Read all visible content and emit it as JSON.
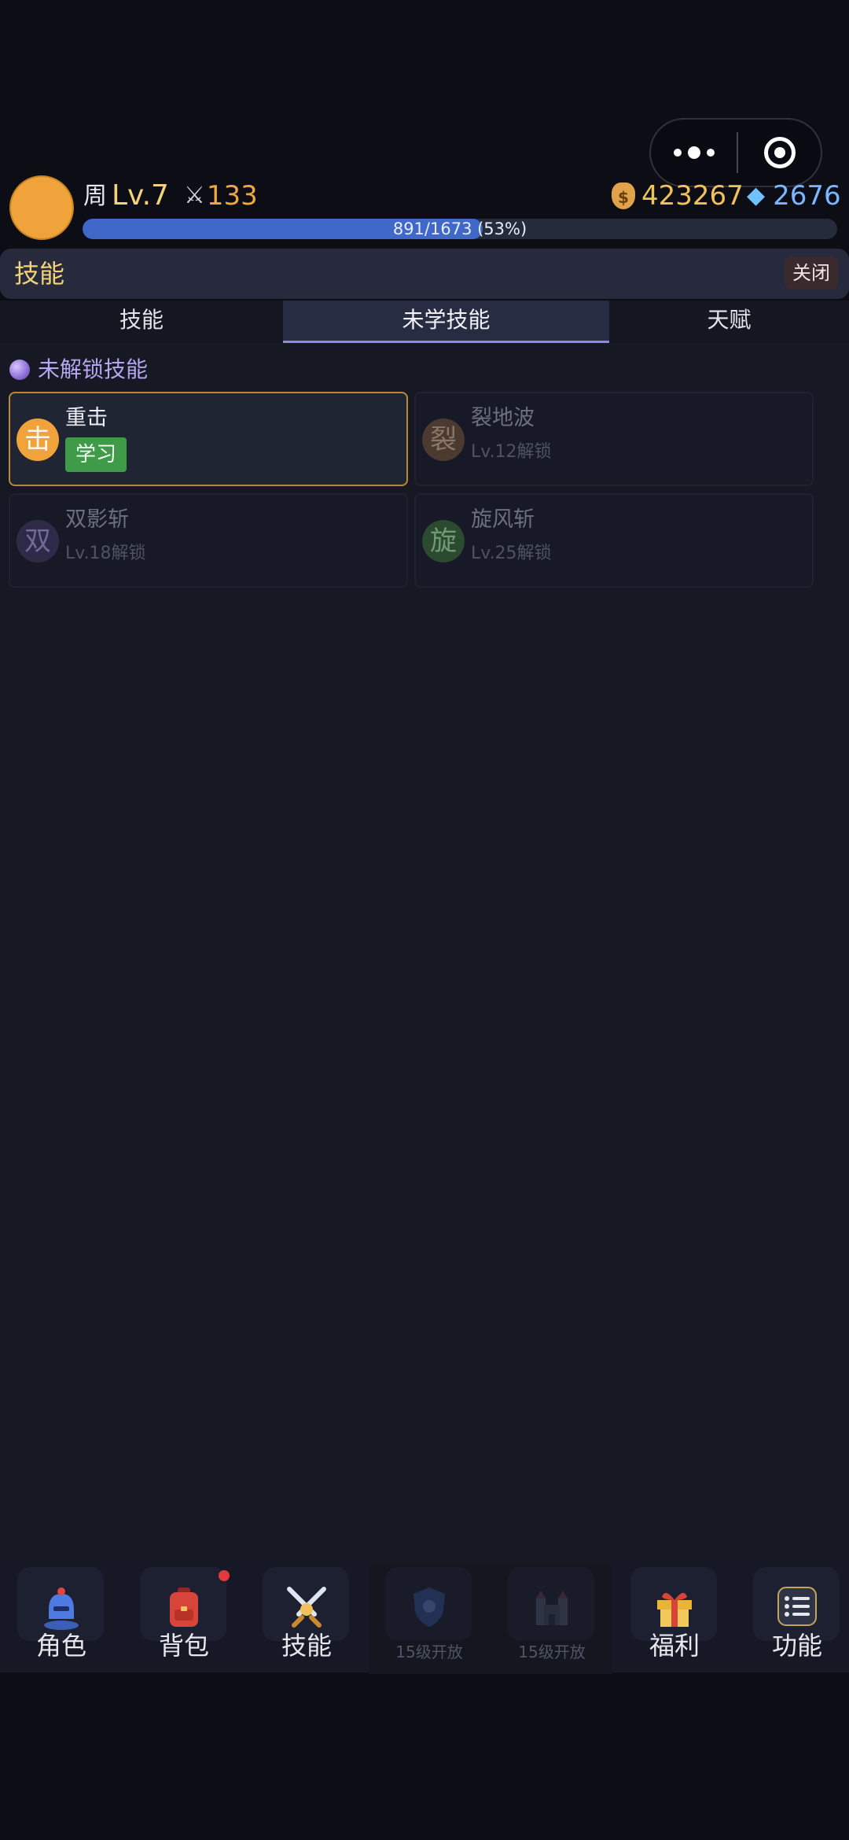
{
  "player": {
    "name": "周",
    "level": "Lv.7",
    "power": "133",
    "gold": "423267",
    "gems": "2676",
    "exp_text": "891/1673 (53%)",
    "exp_fraction": 0.53
  },
  "panel": {
    "title": "技能",
    "close_label": "关闭"
  },
  "tabs": [
    {
      "label": "技能"
    },
    {
      "label": "未学技能"
    },
    {
      "label": "天赋"
    }
  ],
  "section_label": "未解锁技能",
  "skills": [
    {
      "icon": "击",
      "name": "重击",
      "action": "学习",
      "icon_color": "#f0a33b"
    },
    {
      "icon": "裂",
      "name": "裂地波",
      "requirement": "Lv.12解锁",
      "icon_color": "#4a3a30"
    },
    {
      "icon": "双",
      "name": "双影斩",
      "requirement": "Lv.18解锁",
      "icon_color": "#2f2a48"
    },
    {
      "icon": "旋",
      "name": "旋风斩",
      "requirement": "Lv.25解锁",
      "icon_color": "#2c4a30"
    }
  ],
  "nav": [
    {
      "label": "角色",
      "icon": "knight-helmet-icon"
    },
    {
      "label": "背包",
      "icon": "backpack-icon"
    },
    {
      "label": "技能",
      "icon": "crossed-swords-icon"
    },
    {
      "label": "15级开放",
      "icon": "shield-icon"
    },
    {
      "label": "15级开放",
      "icon": "castle-icon"
    },
    {
      "label": "福利",
      "icon": "gift-icon"
    },
    {
      "label": "功能",
      "icon": "menu-list-icon"
    }
  ],
  "colors": {
    "accent_gold": "#f3d27a",
    "exp_blue": "#3f68c8",
    "learn_green": "#3f9b48",
    "tab_underline": "#8c88e6",
    "badge_red": "#e23a3a"
  }
}
